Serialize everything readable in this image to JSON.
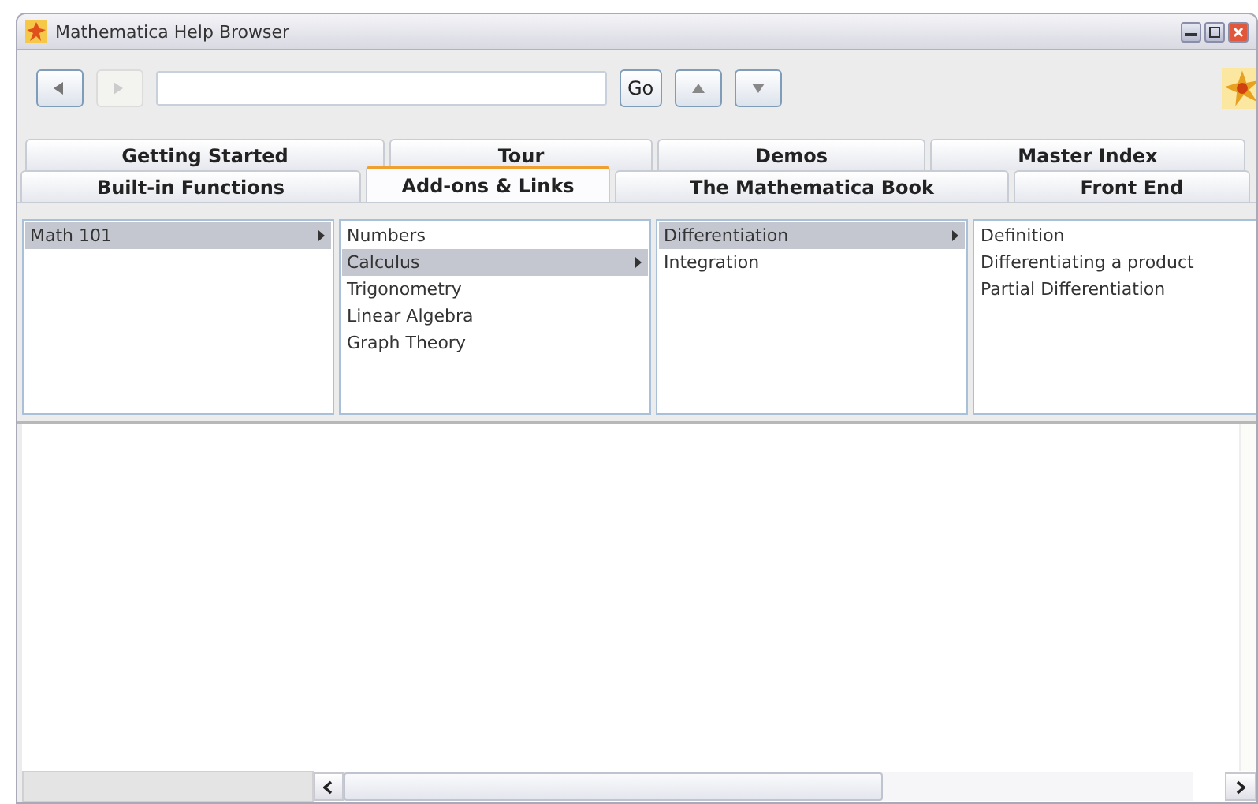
{
  "window": {
    "title": "Mathematica Help Browser"
  },
  "toolbar": {
    "back_disabled": false,
    "forward_disabled": true,
    "go_label": "Go"
  },
  "tab_rows": [
    [
      {
        "label": "Getting Started",
        "selected": false
      },
      {
        "label": "Tour",
        "selected": false
      },
      {
        "label": "Demos",
        "selected": false
      },
      {
        "label": "Master Index",
        "selected": false
      }
    ],
    [
      {
        "label": "Built-in Functions",
        "selected": false
      },
      {
        "label": "Add-ons & Links",
        "selected": true
      },
      {
        "label": "The Mathematica Book",
        "selected": false
      },
      {
        "label": "Front End",
        "selected": false
      }
    ]
  ],
  "columns": [
    [
      {
        "label": "Math 101",
        "selected": true,
        "has_children": true
      }
    ],
    [
      {
        "label": "Numbers",
        "selected": false,
        "has_children": false
      },
      {
        "label": "Calculus",
        "selected": true,
        "has_children": true
      },
      {
        "label": "Trigonometry",
        "selected": false,
        "has_children": false
      },
      {
        "label": "Linear Algebra",
        "selected": false,
        "has_children": false
      },
      {
        "label": "Graph Theory",
        "selected": false,
        "has_children": false
      }
    ],
    [
      {
        "label": "Differentiation",
        "selected": true,
        "has_children": true
      },
      {
        "label": "Integration",
        "selected": false,
        "has_children": false
      }
    ],
    [
      {
        "label": "Definition",
        "selected": false,
        "has_children": false
      },
      {
        "label": "Differentiating a product",
        "selected": false,
        "has_children": false
      },
      {
        "label": "Partial Differentiation",
        "selected": false,
        "has_children": false
      }
    ]
  ]
}
